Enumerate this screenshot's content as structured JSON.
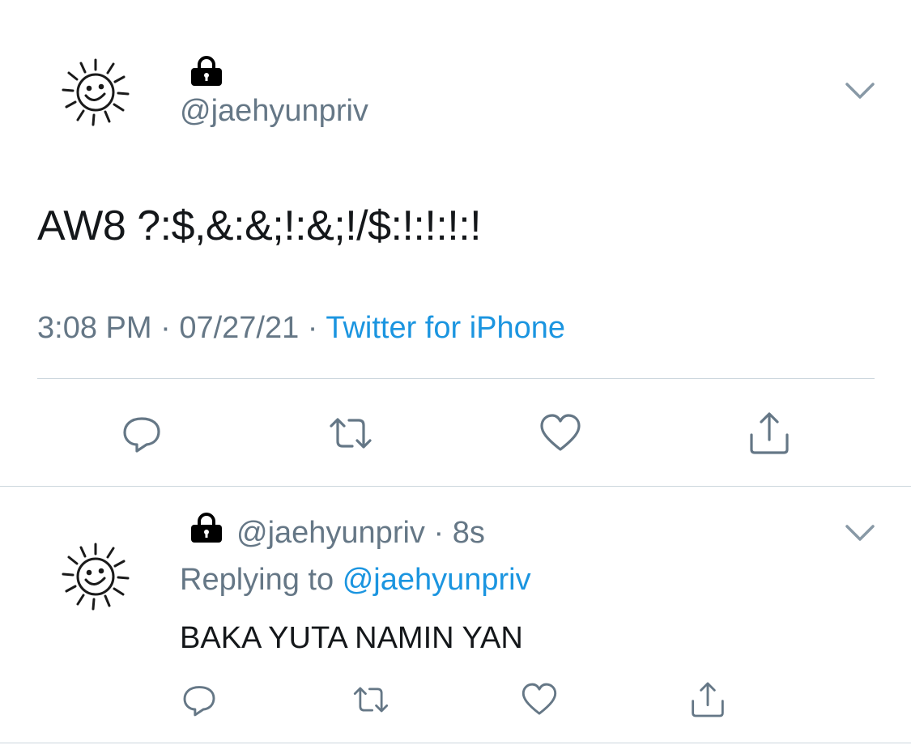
{
  "main_tweet": {
    "avatar_icon": "sun-smiley-icon",
    "lock_icon": "lock-icon",
    "handle": "@jaehyunpriv",
    "text": "AW8 ?:$,&:&;!:&;!/$:!:!:!:!",
    "time": "3:08 PM",
    "date": "07/27/21",
    "separator": "·",
    "source": "Twitter for iPhone",
    "menu_icon": "chevron-down-icon",
    "actions": [
      "reply-icon",
      "retweet-icon",
      "like-icon",
      "share-icon"
    ]
  },
  "reply_tweet": {
    "avatar_icon": "sun-smiley-icon",
    "lock_icon": "lock-icon",
    "handle": "@jaehyunpriv",
    "separator": "·",
    "age": "8s",
    "replying_prefix": "Replying to",
    "replying_handle": "@jaehyunpriv",
    "text": "BAKA YUTA NAMIN YAN",
    "menu_icon": "chevron-down-icon",
    "actions": [
      "reply-icon",
      "retweet-icon",
      "like-icon",
      "share-icon"
    ]
  },
  "colors": {
    "text": "#14171a",
    "secondary": "#657786",
    "link": "#1b95e0",
    "divider": "#ccd6dd"
  }
}
